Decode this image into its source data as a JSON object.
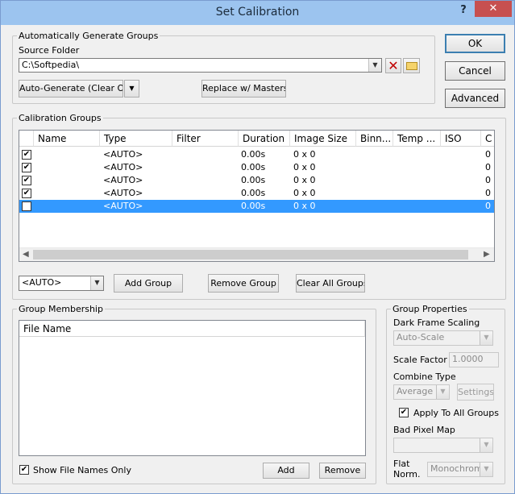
{
  "window": {
    "title": "Set Calibration",
    "help_glyph": "?",
    "close_glyph": "✕"
  },
  "auto_groups": {
    "label": "Automatically Generate Groups",
    "source_folder_label": "Source Folder",
    "source_folder_value": "C:\\Softpedia\\",
    "autogen_label": "Auto-Generate (Clear Old)",
    "replace_label": "Replace w/ Masters"
  },
  "dialog_buttons": {
    "ok": "OK",
    "cancel": "Cancel",
    "advanced": "Advanced"
  },
  "calibration_groups": {
    "label": "Calibration Groups",
    "columns": [
      "Name",
      "Type",
      "Filter",
      "Duration",
      "Image Size",
      "Binn...",
      "Temp ...",
      "ISO",
      "C"
    ],
    "rows": [
      {
        "checked": true,
        "type": "<AUTO>",
        "duration": "0.00s",
        "size": "0 x 0",
        "c": "0",
        "selected": false
      },
      {
        "checked": true,
        "type": "<AUTO>",
        "duration": "0.00s",
        "size": "0 x 0",
        "c": "0",
        "selected": false
      },
      {
        "checked": true,
        "type": "<AUTO>",
        "duration": "0.00s",
        "size": "0 x 0",
        "c": "0",
        "selected": false
      },
      {
        "checked": true,
        "type": "<AUTO>",
        "duration": "0.00s",
        "size": "0 x 0",
        "c": "0",
        "selected": false
      },
      {
        "checked": true,
        "type": "<AUTO>",
        "duration": "0.00s",
        "size": "0 x 0",
        "c": "0",
        "selected": true
      }
    ],
    "group_type_value": "<AUTO>",
    "add_group": "Add Group",
    "remove_group": "Remove Group",
    "clear_all": "Clear All Groups"
  },
  "membership": {
    "label": "Group Membership",
    "column": "File Name",
    "show_names_label": "Show File Names Only",
    "show_names_checked": true,
    "add": "Add",
    "remove": "Remove"
  },
  "properties": {
    "label": "Group Properties",
    "dark_scaling_label": "Dark Frame Scaling",
    "dark_scaling_value": "Auto-Scale",
    "scale_factor_label": "Scale Factor",
    "scale_factor_value": "1.0000",
    "combine_label": "Combine Type",
    "combine_value": "Average",
    "settings": "Settings",
    "apply_all_label": "Apply To All Groups",
    "apply_all_checked": true,
    "bad_pixel_label": "Bad Pixel Map",
    "bad_pixel_value": "",
    "flat_label_1": "Flat",
    "flat_label_2": "Norm.",
    "flat_value": "Monochrome"
  },
  "glyphs": {
    "check": "✔",
    "dropdown": "▼",
    "left": "◀",
    "right": "▶"
  },
  "colors": {
    "selection": "#3399ff",
    "titlebar": "#9cc4ef",
    "close": "#c75050"
  }
}
